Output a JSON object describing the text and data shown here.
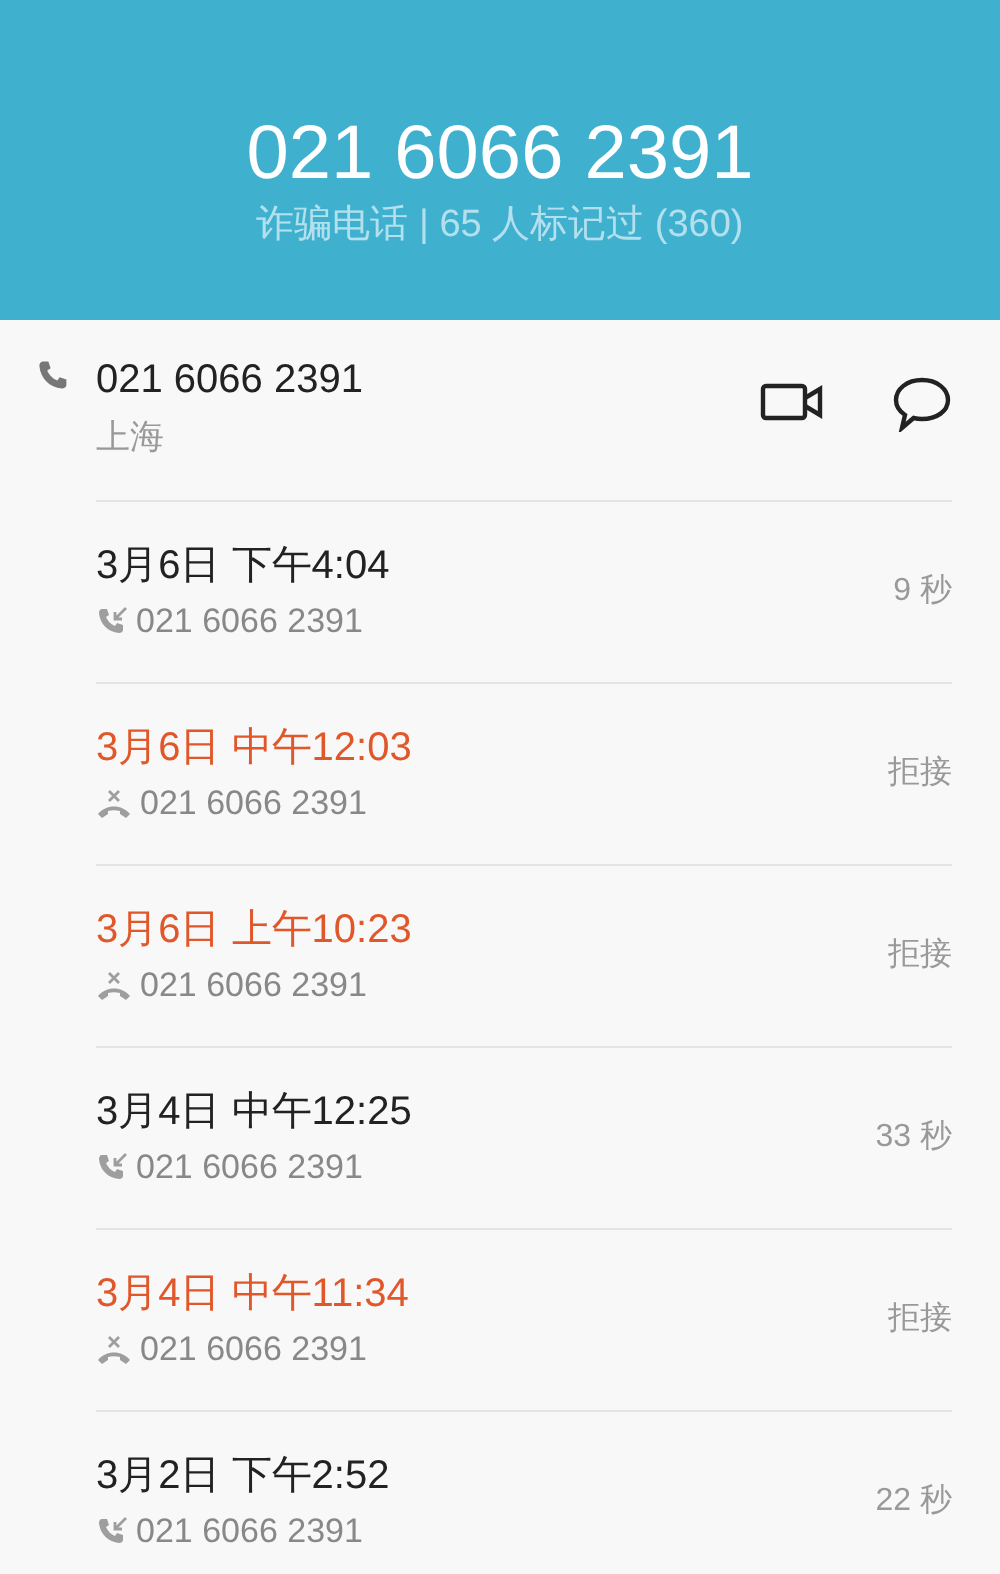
{
  "header": {
    "number": "021 6066 2391",
    "subtitle": "诈骗电话 | 65 人标记过 (360)"
  },
  "contact": {
    "number": "021 6066 2391",
    "location": "上海"
  },
  "calls": [
    {
      "time": "3月6日 下午4:04",
      "number": "021 6066 2391",
      "kind": "incoming",
      "status": "9 秒"
    },
    {
      "time": "3月6日 中午12:03",
      "number": "021 6066 2391",
      "kind": "rejected",
      "status": "拒接"
    },
    {
      "time": "3月6日 上午10:23",
      "number": "021 6066 2391",
      "kind": "rejected",
      "status": "拒接"
    },
    {
      "time": "3月4日 中午12:25",
      "number": "021 6066 2391",
      "kind": "incoming",
      "status": "33 秒"
    },
    {
      "time": "3月4日 中午11:34",
      "number": "021 6066 2391",
      "kind": "rejected",
      "status": "拒接"
    },
    {
      "time": "3月2日 下午2:52",
      "number": "021 6066 2391",
      "kind": "incoming",
      "status": "22 秒"
    }
  ]
}
